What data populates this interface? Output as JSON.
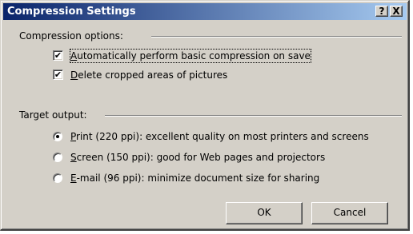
{
  "window": {
    "title": "Compression Settings",
    "help_label": "?",
    "close_label": "X"
  },
  "compression_group": {
    "label": "Compression options:",
    "options": [
      {
        "mnemonic": "A",
        "rest": "utomatically perform basic compression on save",
        "checked": true
      },
      {
        "mnemonic": "D",
        "rest": "elete cropped areas of pictures",
        "checked": true
      }
    ]
  },
  "target_group": {
    "label": "Target output:",
    "options": [
      {
        "mnemonic": "P",
        "rest": "rint (220 ppi): excellent quality on most printers and screens",
        "selected": true
      },
      {
        "mnemonic": "S",
        "rest": "creen (150 ppi): good for Web pages and projectors",
        "selected": false
      },
      {
        "mnemonic": "E",
        "rest": "-mail (96 ppi): minimize document size for sharing",
        "selected": false
      }
    ]
  },
  "buttons": {
    "ok_label": "OK",
    "cancel_label": "Cancel"
  },
  "icons": {
    "check_glyph": "✔"
  }
}
